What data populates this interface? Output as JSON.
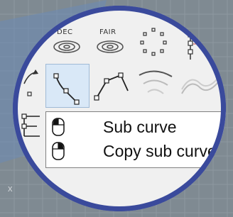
{
  "toolbar": {
    "row1": [
      {
        "label": "DEC",
        "icon": "decimate-curve-icon"
      },
      {
        "label": "FAIR",
        "icon": "fair-curve-icon"
      },
      {
        "label": "",
        "icon": "point-cloud-icon"
      },
      {
        "label": "",
        "icon": "vertical-points-icon"
      }
    ],
    "row2": [
      {
        "icon": "curve-arrow-icon"
      },
      {
        "icon": "sub-curve-icon",
        "selected": true
      },
      {
        "icon": "control-polygon-icon"
      },
      {
        "icon": "offset-arcs-icon"
      },
      {
        "icon": "wave-lines-icon"
      }
    ]
  },
  "popup": {
    "items": [
      {
        "label": "Sub curve",
        "mouse_button": "left-mouse-icon"
      },
      {
        "label": "Copy sub curve",
        "mouse_button": "right-mouse-icon"
      }
    ]
  },
  "viewport": {
    "axis_label": "x"
  },
  "colors": {
    "ring": "#3a4a9c",
    "selected_bg": "#d9e8f7",
    "grid": "#8f9aa3"
  }
}
